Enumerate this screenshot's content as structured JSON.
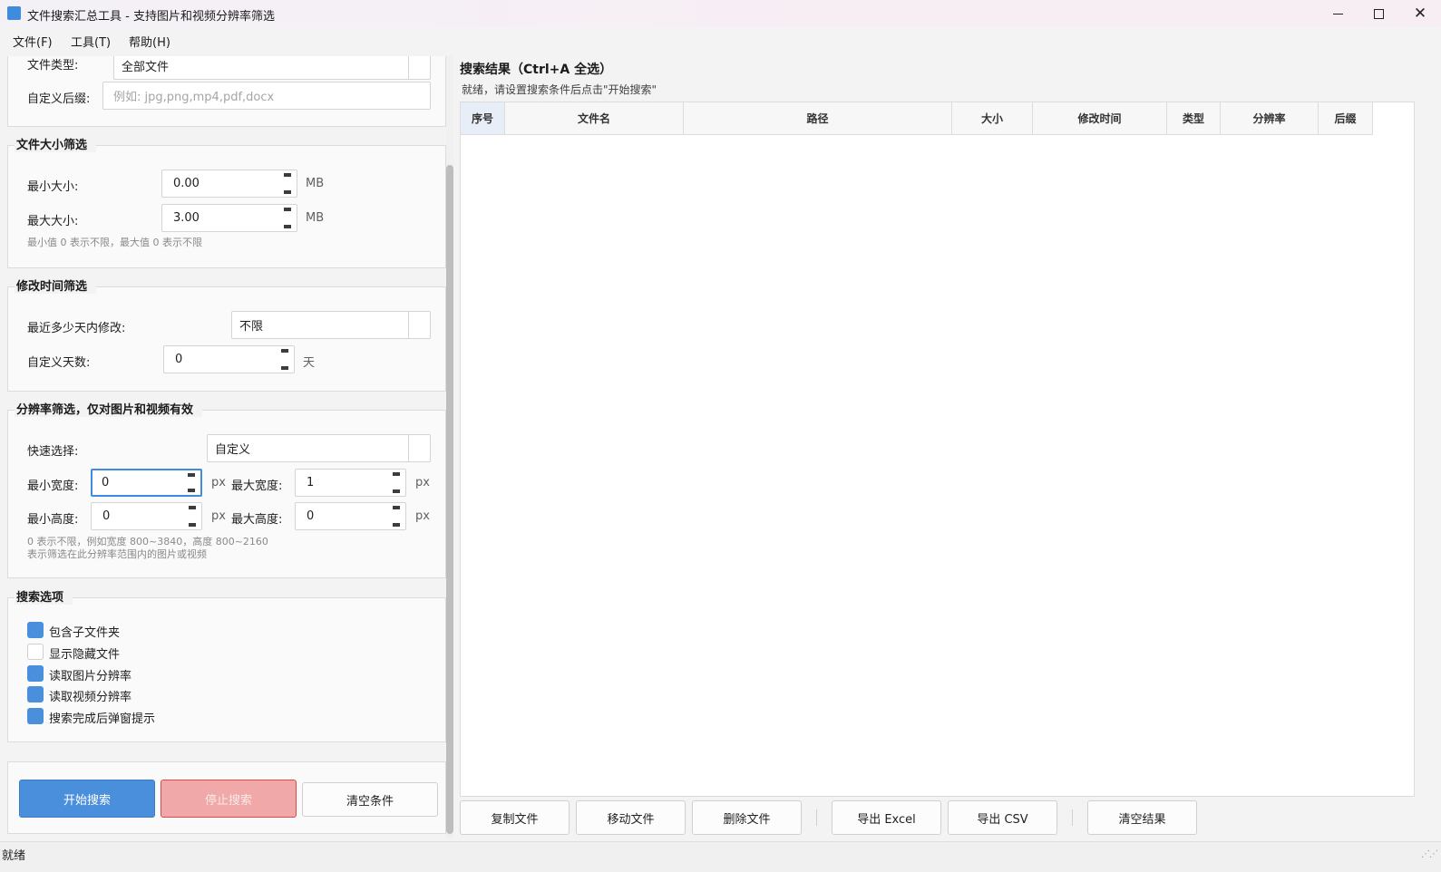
{
  "window": {
    "title": "文件搜索汇总工具 - 支持图片和视频分辨率筛选",
    "min_glyph": "",
    "close_glyph": "✕"
  },
  "menu": [
    "文件(F)",
    "工具(T)",
    "帮助(H)"
  ],
  "file_type": {
    "label": "文件类型:",
    "value": "全部文件",
    "ext_label": "自定义后缀:",
    "ext_placeholder": "例如: jpg,png,mp4,pdf,docx"
  },
  "size_filter": {
    "title": "文件大小筛选",
    "min_label": "最小大小:",
    "min_value": "0.00",
    "max_label": "最大大小:",
    "max_value": "3.00",
    "unit": "MB",
    "hint": "最小值 0 表示不限，最大值 0 表示不限"
  },
  "time_filter": {
    "title": "修改时间筛选",
    "recent_label": "最近多少天内修改:",
    "recent_value": "不限",
    "days_label": "自定义天数:",
    "days_value": "0",
    "days_unit": "天"
  },
  "resolution_filter": {
    "title": "分辨率筛选，仅对图片和视频有效",
    "quick_label": "快速选择:",
    "quick_value": "自定义",
    "min_w_label": "最小宽度:",
    "min_w_value": "0",
    "max_w_label": "最大宽度:",
    "max_w_value": "1",
    "min_h_label": "最小高度:",
    "min_h_value": "0",
    "max_h_label": "最大高度:",
    "max_h_value": "0",
    "unit": "px",
    "hint1": "0 表示不限，例如宽度 800~3840，高度 800~2160",
    "hint2": "表示筛选在此分辨率范围内的图片或视频"
  },
  "search_options": {
    "title": "搜索选项",
    "items": [
      {
        "label": "包含子文件夹",
        "checked": true
      },
      {
        "label": "显示隐藏文件",
        "checked": false
      },
      {
        "label": "读取图片分辨率",
        "checked": true
      },
      {
        "label": "读取视频分辨率",
        "checked": true
      },
      {
        "label": "搜索完成后弹窗提示",
        "checked": true
      }
    ]
  },
  "actions": {
    "start": "开始搜索",
    "stop": "停止搜索",
    "clear": "清空条件"
  },
  "results": {
    "title": "搜索结果（Ctrl+A 全选）",
    "status": "就绪，请设置搜索条件后点击\"开始搜索\"",
    "columns": [
      "序号",
      "文件名",
      "路径",
      "大小",
      "修改时间",
      "类型",
      "分辨率",
      "后缀"
    ],
    "rows": []
  },
  "result_buttons": {
    "copy": "复制文件",
    "move": "移动文件",
    "delete": "删除文件",
    "export_excel": "导出 Excel",
    "export_csv": "导出 CSV",
    "clear": "清空结果"
  },
  "statusbar": {
    "text": "就绪",
    "grip": "⋰⋰"
  },
  "colors": {
    "accent": "#4a8fdb",
    "stop_bg": "#f0a8a8",
    "stop_border": "#d94b4b"
  }
}
